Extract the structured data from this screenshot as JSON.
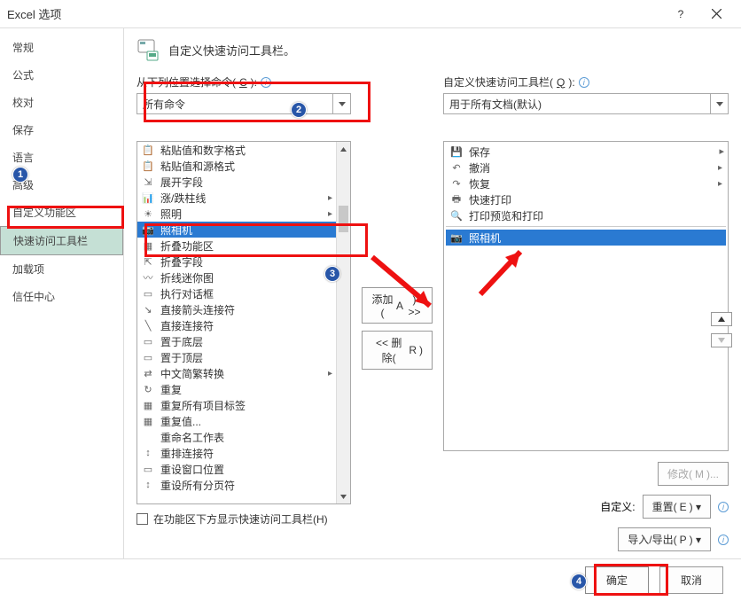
{
  "window": {
    "title": "Excel 选项",
    "help": "?",
    "close": "×"
  },
  "sidebar": {
    "items": [
      {
        "label": "常规"
      },
      {
        "label": "公式"
      },
      {
        "label": "校对"
      },
      {
        "label": "保存"
      },
      {
        "label": "语言"
      },
      {
        "label": "高级"
      },
      {
        "label": "自定义功能区"
      },
      {
        "label": "快速访问工具栏"
      },
      {
        "label": "加载项"
      },
      {
        "label": "信任中心"
      }
    ],
    "selectedIndex": 7
  },
  "header": {
    "title": "自定义快速访问工具栏。"
  },
  "left": {
    "label_pre": "从下列位置选择命令(",
    "label_u": "C",
    "label_post": "):",
    "combo": "所有命令",
    "items": [
      {
        "icon": "📋",
        "label": "粘贴值和数字格式"
      },
      {
        "icon": "📋",
        "label": "粘贴值和源格式"
      },
      {
        "icon": "⇲",
        "label": "展开字段"
      },
      {
        "icon": "📊",
        "label": "涨/跌柱线",
        "sub": "▸"
      },
      {
        "icon": "☀",
        "label": "照明",
        "sub": "▸"
      },
      {
        "icon": "📷",
        "label": "照相机"
      },
      {
        "icon": "▦",
        "label": "折叠功能区"
      },
      {
        "icon": "⇱",
        "label": "折叠字段"
      },
      {
        "icon": "〰",
        "label": "折线迷你图"
      },
      {
        "icon": "▭",
        "label": "执行对话框"
      },
      {
        "icon": "↘",
        "label": "直接箭头连接符"
      },
      {
        "icon": "╲",
        "label": "直接连接符"
      },
      {
        "icon": "▭",
        "label": "置于底层"
      },
      {
        "icon": "▭",
        "label": "置于顶层"
      },
      {
        "icon": "⇄",
        "label": "中文简繁转换",
        "sub": "▸"
      },
      {
        "icon": "↻",
        "label": "重复"
      },
      {
        "icon": "▦",
        "label": "重复所有项目标签"
      },
      {
        "icon": "▦",
        "label": "重复值..."
      },
      {
        "icon": "",
        "label": "重命名工作表"
      },
      {
        "icon": "↕",
        "label": "重排连接符"
      },
      {
        "icon": "▭",
        "label": "重设窗口位置"
      },
      {
        "icon": "↕",
        "label": "重设所有分页符"
      }
    ],
    "selectedIndex": 5,
    "checkbox_pre": "在功能区下方显示快速访问工具栏(",
    "checkbox_u": "H",
    "checkbox_post": ")"
  },
  "mid": {
    "add_pre": "添加(",
    "add_u": "A",
    "add_post": ") >>",
    "remove_pre": "<< 删除(",
    "remove_u": "R",
    "remove_post": ")"
  },
  "right": {
    "label_pre": "自定义快速访问工具栏(",
    "label_u": "Q",
    "label_post": "):",
    "combo": "用于所有文档(默认)",
    "items": [
      {
        "icon": "💾",
        "label": "保存"
      },
      {
        "icon": "↶",
        "label": "撤消",
        "sub": "▸"
      },
      {
        "icon": "↷",
        "label": "恢复",
        "sub": "▸"
      },
      {
        "icon": "🖶",
        "label": "快速打印"
      },
      {
        "icon": "🔍",
        "label": "打印预览和打印"
      },
      {
        "sep": true
      },
      {
        "icon": "📷",
        "label": "照相机"
      }
    ],
    "selectedIndex": 6,
    "modify_pre": "修改(",
    "modify_u": "M",
    "modify_post": ")...",
    "custom_label": "自定义:",
    "reset_pre": "重置(",
    "reset_u": "E",
    "reset_post": ") ▾",
    "import_pre": "导入/导出(",
    "import_u": "P",
    "import_post": ") ▾"
  },
  "footer": {
    "ok": "确定",
    "cancel": "取消"
  }
}
